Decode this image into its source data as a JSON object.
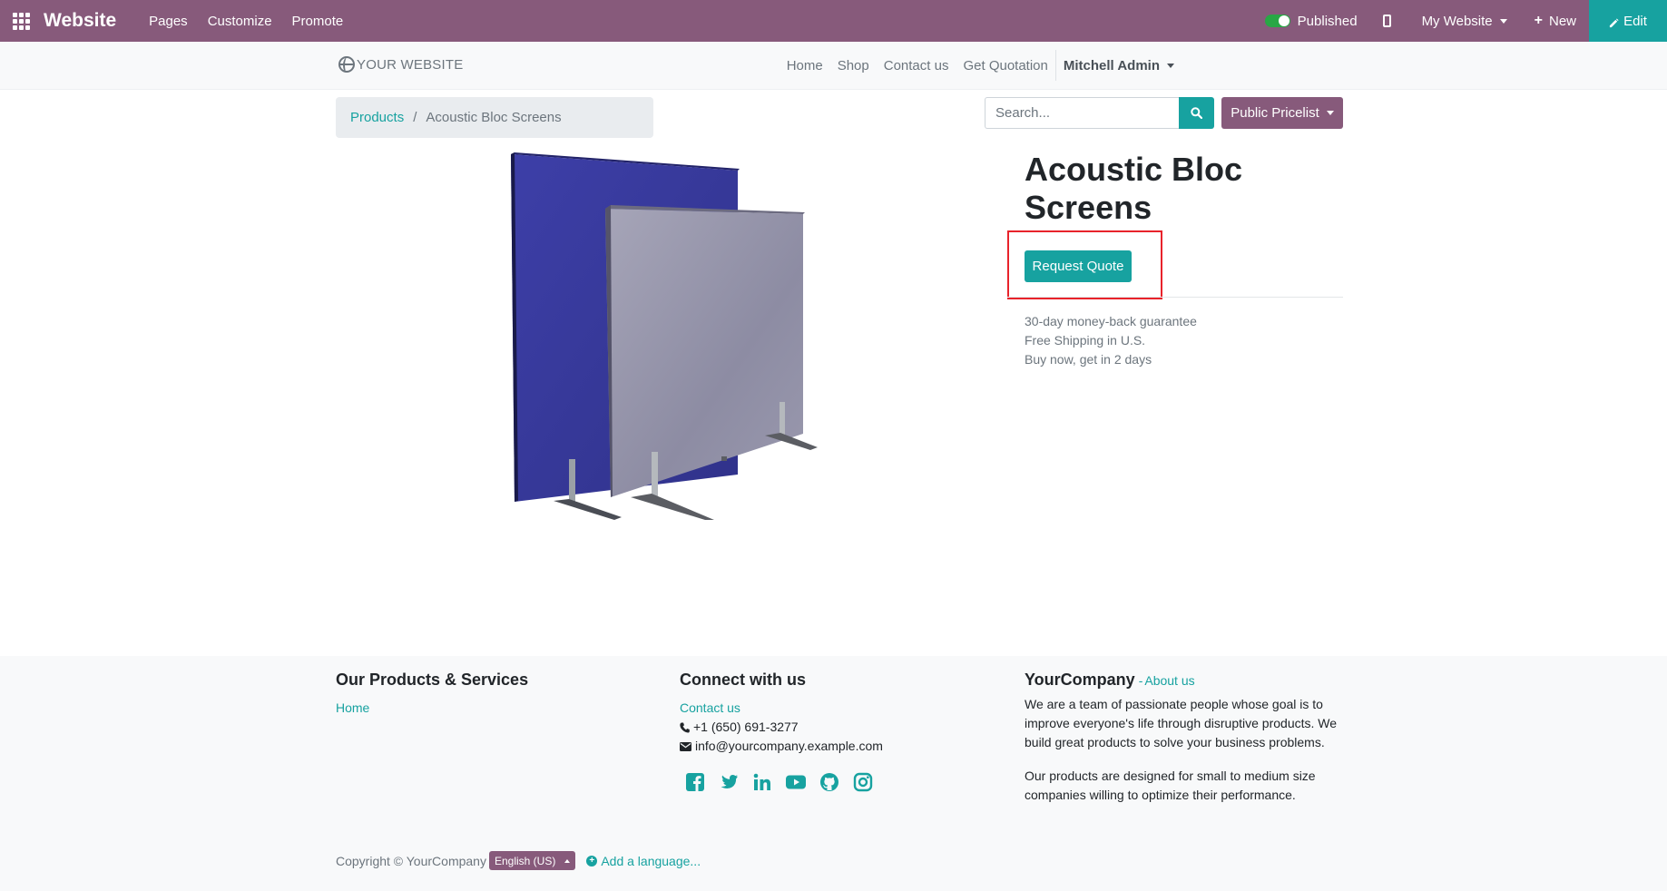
{
  "topbar": {
    "app_name": "Website",
    "menu": [
      "Pages",
      "Customize",
      "Promote"
    ],
    "published_label": "Published",
    "website_selector": "My Website",
    "new_label": "New",
    "edit_label": "Edit",
    "brand_color": "#875a7b",
    "accent_color": "#17a2a0"
  },
  "header": {
    "logo_text": "YOUR WEBSITE",
    "nav": [
      "Home",
      "Shop",
      "Contact us",
      "Get Quotation"
    ],
    "user": "Mitchell Admin"
  },
  "breadcrumb": {
    "parent": "Products",
    "separator": "/",
    "current": "Acoustic Bloc Screens"
  },
  "search": {
    "placeholder": "Search...",
    "pricelist": "Public Pricelist"
  },
  "product": {
    "title": "Acoustic Bloc Screens",
    "cta": "Request Quote",
    "guarantees": [
      "30-day money-back guarantee",
      "Free Shipping in U.S.",
      "Buy now, get in 2 days"
    ],
    "highlight_color": "#e8232b"
  },
  "footer": {
    "col1": {
      "heading": "Our Products & Services",
      "link": "Home"
    },
    "col2": {
      "heading": "Connect with us",
      "contact_link": "Contact us",
      "phone": "+1 (650) 691-3277",
      "email": "info@yourcompany.example.com",
      "social_icons": [
        "facebook-icon",
        "twitter-icon",
        "linkedin-icon",
        "youtube-icon",
        "github-icon",
        "instagram-icon"
      ]
    },
    "col3": {
      "company": "YourCompany",
      "separator": "-",
      "about_link": "About us",
      "para1": "We are a team of passionate people whose goal is to improve everyone's life through disruptive products. We build great products to solve your business problems.",
      "para2": "Our products are designed for small to medium size companies willing to optimize their performance."
    },
    "copyright": "Copyright © YourCompany",
    "language": "English (US)",
    "add_language": "Add a language..."
  }
}
